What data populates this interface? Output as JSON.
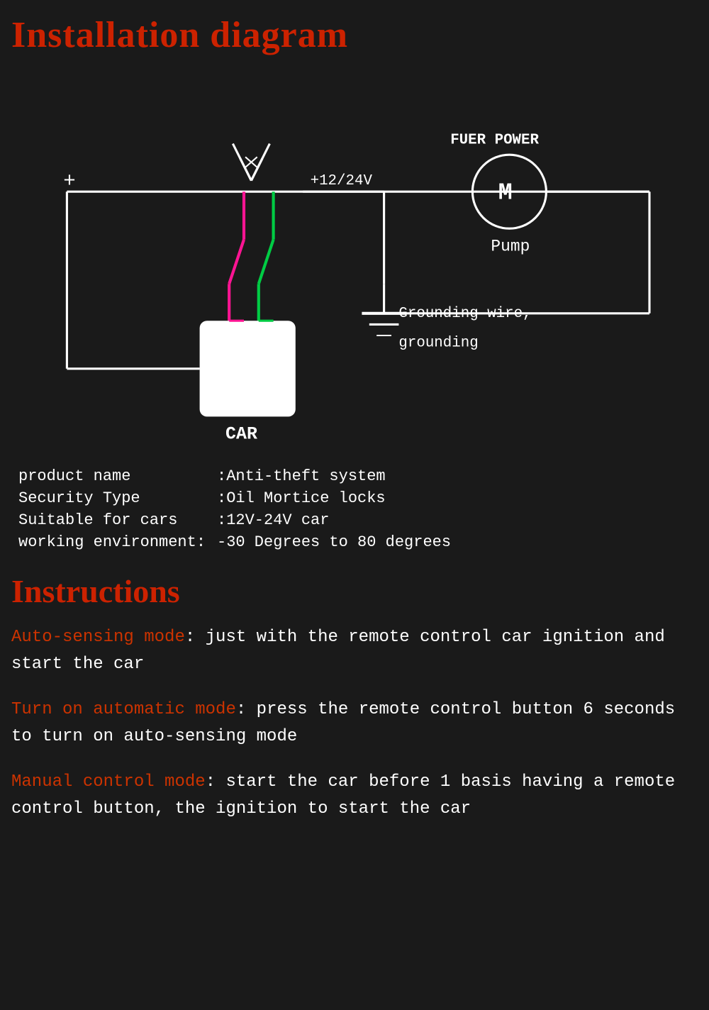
{
  "page": {
    "title": "Installation diagram",
    "background": "#1a1a1a"
  },
  "diagram": {
    "labels": {
      "plus": "+",
      "fuer_power": "FUER POWER",
      "voltage": "+12/24V",
      "motor": "M",
      "pump": "Pump",
      "grounding": "Grounding wire,\ngrounding",
      "car": "CAR"
    }
  },
  "specs": [
    {
      "label": "product name",
      "value": ":Anti-theft system"
    },
    {
      "label": "Security Type",
      "value": ":Oil Mortice locks"
    },
    {
      "label": "Suitable for cars",
      "value": ":12V-24V car"
    },
    {
      "label": "working environment",
      "value": ":-30 Degrees to 80 degrees"
    }
  ],
  "instructions_title": "Instructions",
  "instructions": [
    {
      "label": "Auto-sensing mode",
      "text": ": just with the remote control car ignition and start the car"
    },
    {
      "label": "Turn on automatic mode",
      "text": ": press the remote control button 6 seconds to turn on auto-sensing mode"
    },
    {
      "label": "Manual control mode",
      "text": ": start the car before 1 basis having a remote control button, the ignition to start the car"
    }
  ]
}
